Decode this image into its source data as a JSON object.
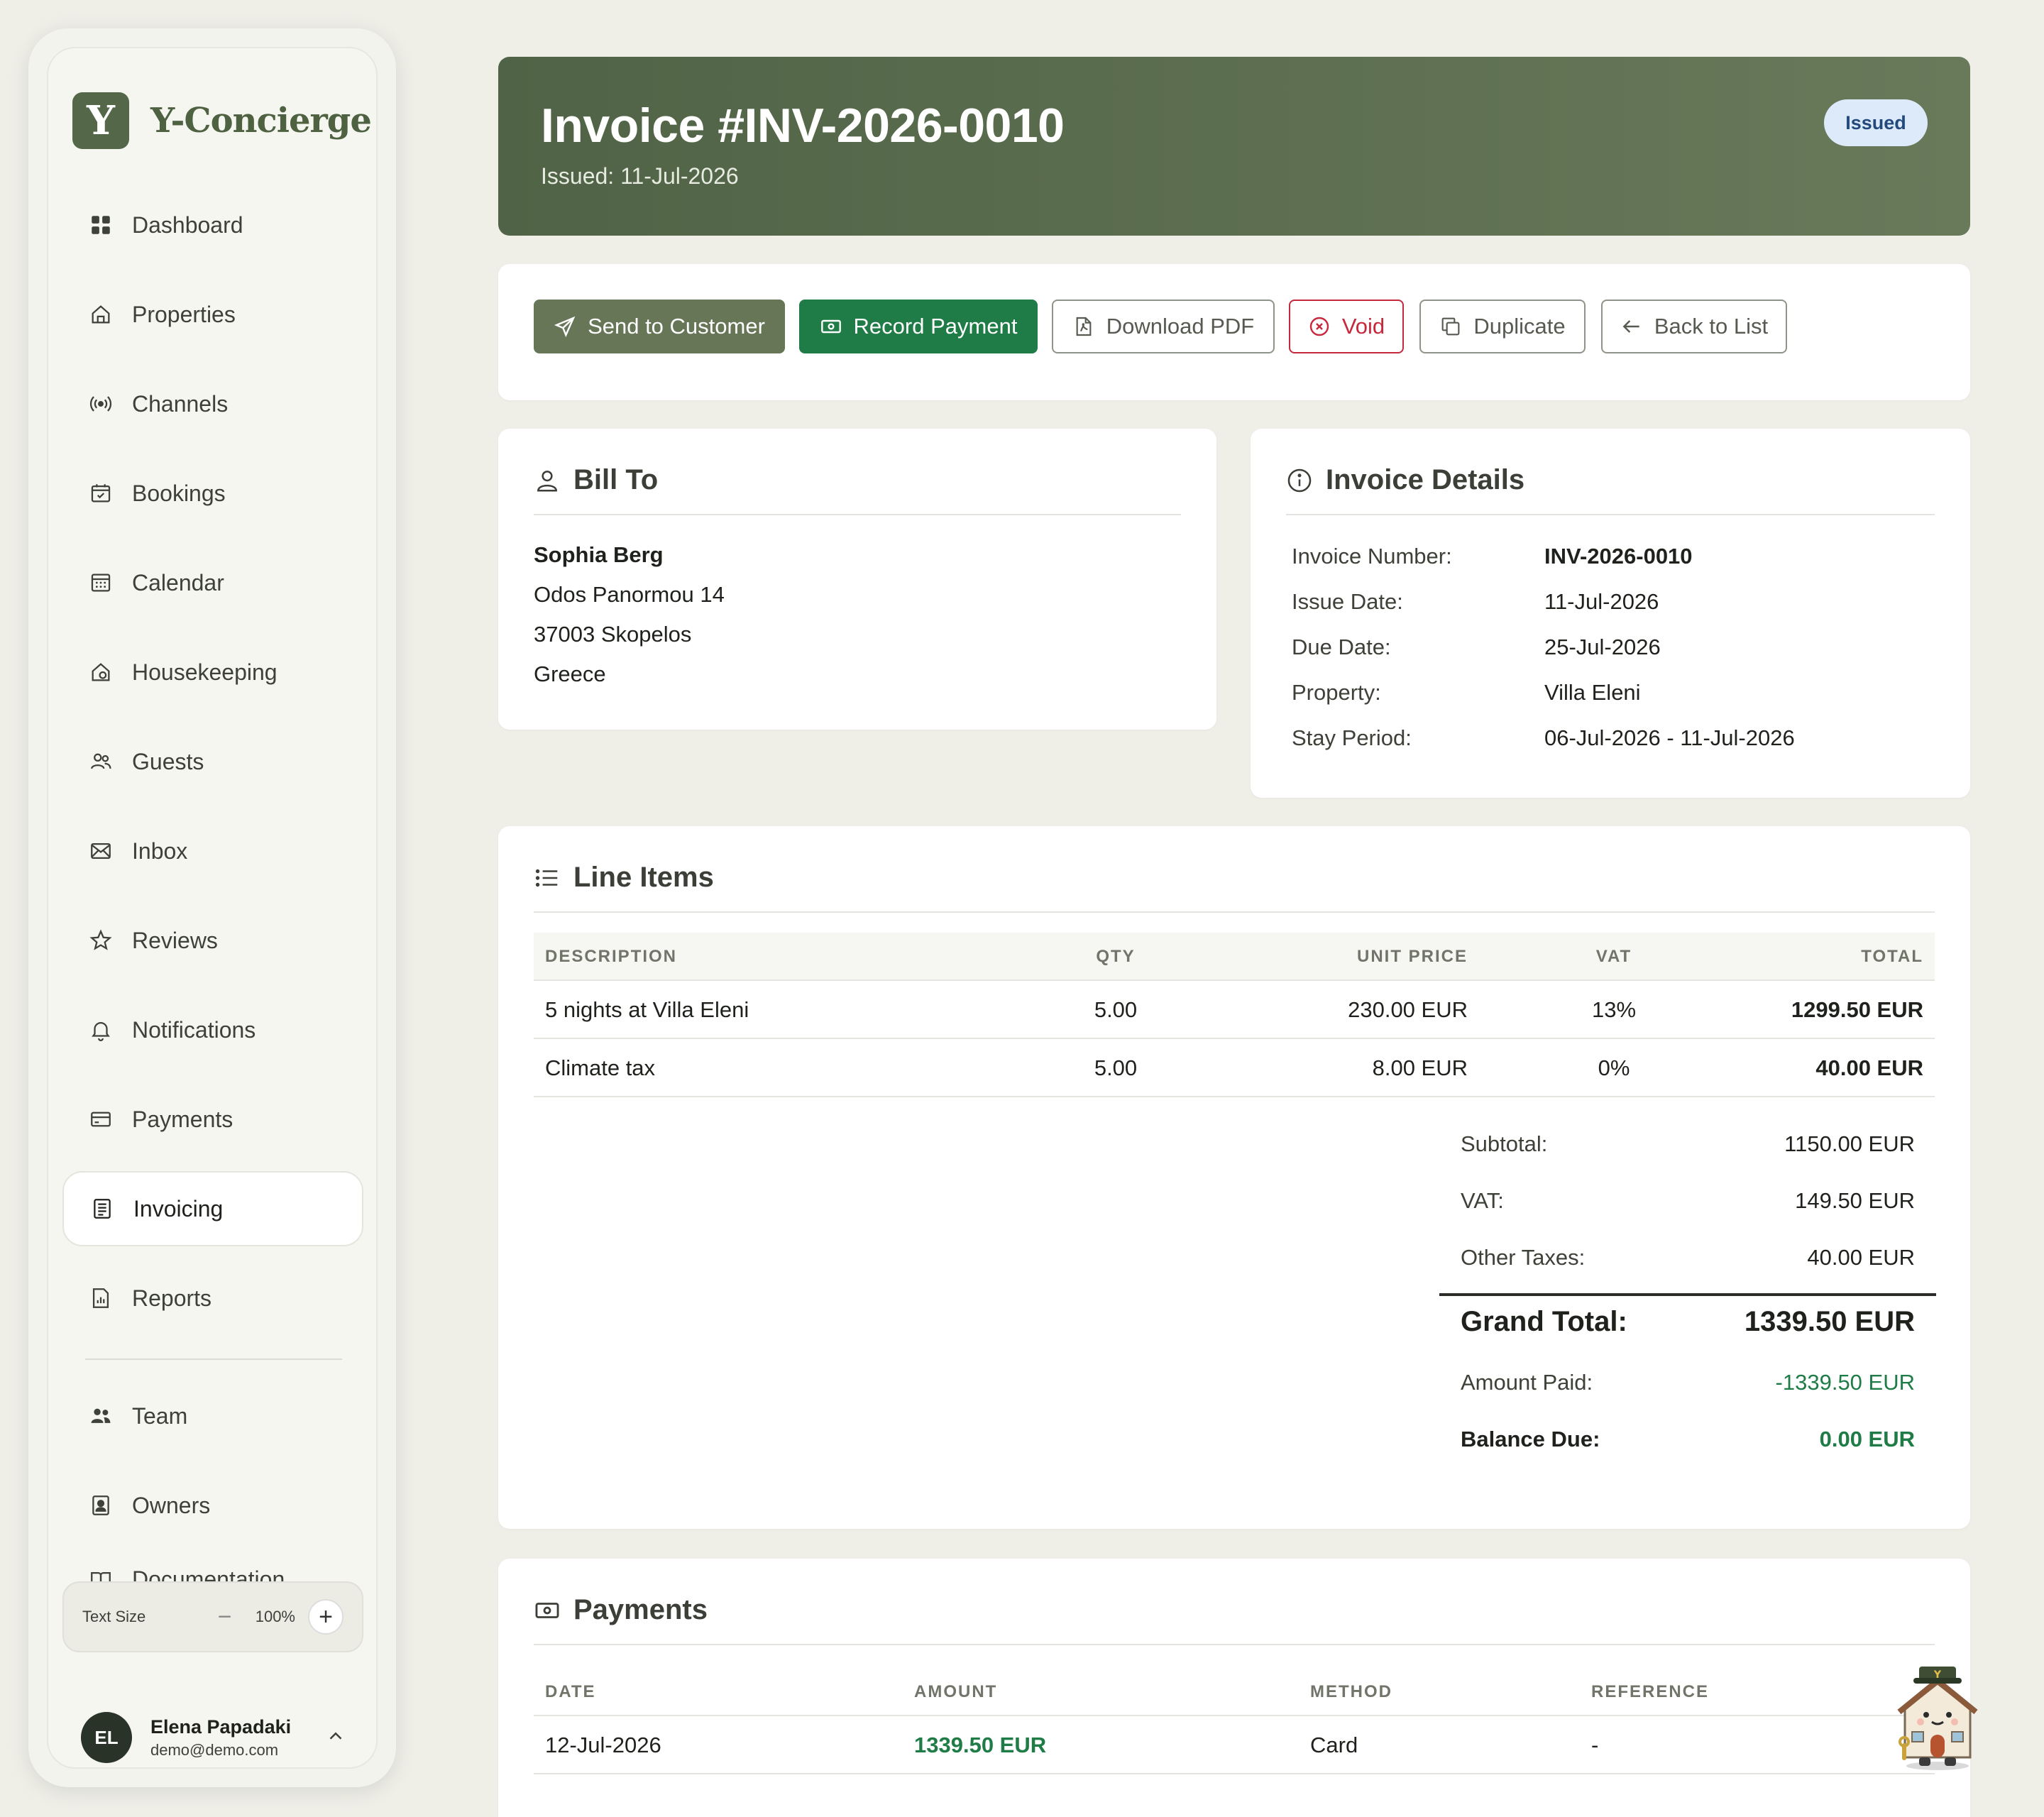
{
  "brand": {
    "logo_letter": "Y",
    "name": "Y-Concierge"
  },
  "sidebar": {
    "items": [
      {
        "label": "Dashboard",
        "icon": "grid-icon"
      },
      {
        "label": "Properties",
        "icon": "house-icon"
      },
      {
        "label": "Channels",
        "icon": "broadcast-icon"
      },
      {
        "label": "Bookings",
        "icon": "calendar-check-icon"
      },
      {
        "label": "Calendar",
        "icon": "calendar-icon"
      },
      {
        "label": "Housekeeping",
        "icon": "house-clean-icon"
      },
      {
        "label": "Guests",
        "icon": "users-icon"
      },
      {
        "label": "Inbox",
        "icon": "mail-icon"
      },
      {
        "label": "Reviews",
        "icon": "star-icon"
      },
      {
        "label": "Notifications",
        "icon": "bell-icon"
      },
      {
        "label": "Payments",
        "icon": "credit-card-icon"
      },
      {
        "label": "Invoicing",
        "icon": "invoice-icon",
        "active": true
      },
      {
        "label": "Reports",
        "icon": "report-icon"
      }
    ],
    "secondary_items": [
      {
        "label": "Team",
        "icon": "team-icon"
      },
      {
        "label": "Owners",
        "icon": "owner-icon"
      },
      {
        "label": "Documentation",
        "icon": "book-icon"
      }
    ],
    "text_size": {
      "label": "Text Size",
      "value": "100%",
      "minus": "−",
      "plus": "+"
    },
    "user": {
      "initials": "EL",
      "name": "Elena Papadaki",
      "email": "demo@demo.com"
    }
  },
  "header": {
    "title": "Invoice #INV-2026-0010",
    "subtitle": "Issued: 11-Jul-2026",
    "status_badge": "Issued"
  },
  "actions": {
    "send": "Send to Customer",
    "record_payment": "Record Payment",
    "download_pdf": "Download PDF",
    "void": "Void",
    "duplicate": "Duplicate",
    "back": "Back to List"
  },
  "bill_to": {
    "title": "Bill To",
    "name": "Sophia Berg",
    "address1": "Odos Panormou 14",
    "address2": "37003 Skopelos",
    "country": "Greece"
  },
  "details": {
    "title": "Invoice Details",
    "rows": [
      {
        "label": "Invoice Number:",
        "value": "INV-2026-0010"
      },
      {
        "label": "Issue Date:",
        "value": "11-Jul-2026"
      },
      {
        "label": "Due Date:",
        "value": "25-Jul-2026"
      },
      {
        "label": "Property:",
        "value": "Villa Eleni"
      },
      {
        "label": "Stay Period:",
        "value": "06-Jul-2026 - 11-Jul-2026"
      }
    ]
  },
  "line_items": {
    "title": "Line Items",
    "columns": {
      "description": "DESCRIPTION",
      "qty": "QTY",
      "unit_price": "UNIT PRICE",
      "vat": "VAT",
      "total": "TOTAL"
    },
    "rows": [
      {
        "description": "5 nights at Villa Eleni",
        "qty": "5.00",
        "unit_price": "230.00 EUR",
        "vat": "13%",
        "total": "1299.50 EUR"
      },
      {
        "description": "Climate tax",
        "qty": "5.00",
        "unit_price": "8.00 EUR",
        "vat": "0%",
        "total": "40.00 EUR"
      }
    ],
    "totals": {
      "subtotal_label": "Subtotal:",
      "subtotal": "1150.00 EUR",
      "vat_label": "VAT:",
      "vat": "149.50 EUR",
      "other_label": "Other Taxes:",
      "other": "40.00 EUR",
      "grand_label": "Grand Total:",
      "grand": "1339.50 EUR",
      "paid_label": "Amount Paid:",
      "paid": "-1339.50 EUR",
      "balance_label": "Balance Due:",
      "balance": "0.00 EUR"
    }
  },
  "payments": {
    "title": "Payments",
    "columns": {
      "date": "DATE",
      "amount": "AMOUNT",
      "method": "METHOD",
      "reference": "REFERENCE"
    },
    "rows": [
      {
        "date": "12-Jul-2026",
        "amount": "1339.50 EUR",
        "method": "Card",
        "reference": "-"
      }
    ]
  },
  "colors": {
    "accent": "#546748",
    "success": "#1f7c46",
    "danger": "#c6283c",
    "badge_bg": "#dceafa"
  }
}
